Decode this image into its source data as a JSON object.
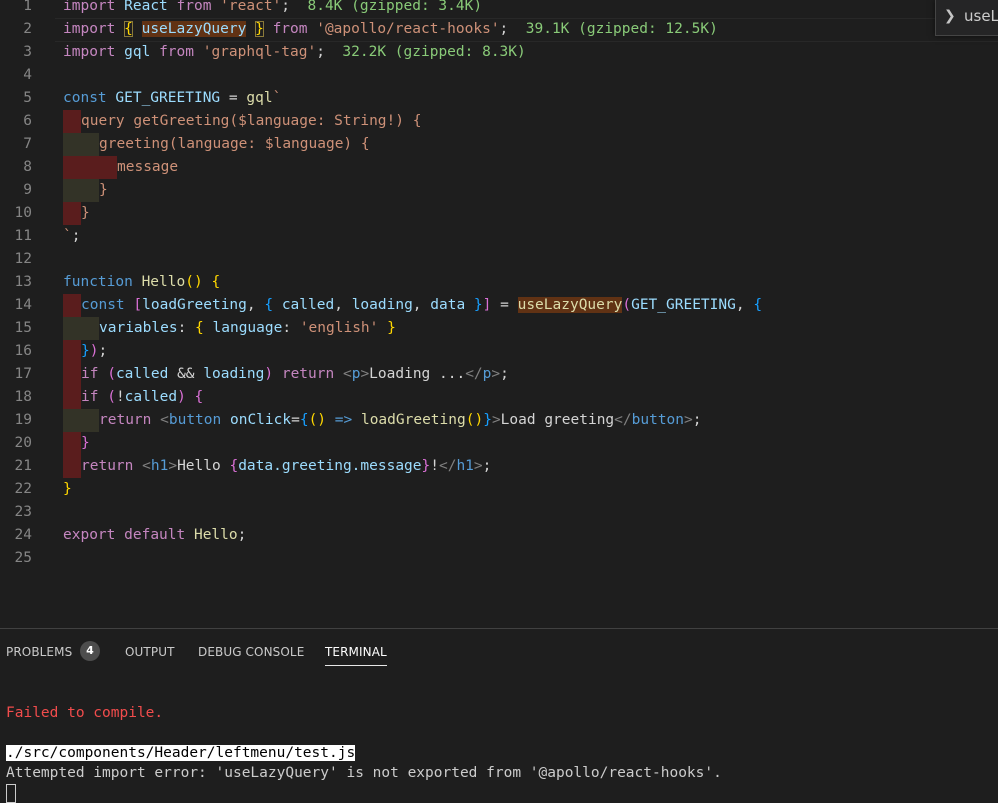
{
  "peek": {
    "text": "useLa"
  },
  "code_lines": [
    {
      "n": "1"
    },
    {
      "n": "2"
    },
    {
      "n": "3"
    },
    {
      "n": "4"
    },
    {
      "n": "5"
    },
    {
      "n": "6"
    },
    {
      "n": "7"
    },
    {
      "n": "8"
    },
    {
      "n": "9"
    },
    {
      "n": "10"
    },
    {
      "n": "11"
    },
    {
      "n": "12"
    },
    {
      "n": "13"
    },
    {
      "n": "14"
    },
    {
      "n": "15"
    },
    {
      "n": "16"
    },
    {
      "n": "17"
    },
    {
      "n": "18"
    },
    {
      "n": "19"
    },
    {
      "n": "20"
    },
    {
      "n": "21"
    },
    {
      "n": "22"
    },
    {
      "n": "23"
    },
    {
      "n": "24"
    },
    {
      "n": "25"
    }
  ],
  "code": {
    "l1": {
      "import_kw": "import",
      "name": "React",
      "from_kw": "from",
      "module": "'react'",
      "size": "8.4K (gzipped: 3.4K)"
    },
    "l2": {
      "import_kw": "import",
      "open": "{",
      "name": "useLazyQuery",
      "close": "}",
      "from_kw": "from",
      "module": "'@apollo/react-hooks'",
      "size": "39.1K (gzipped: 12.5K)"
    },
    "l3": {
      "import_kw": "import",
      "name": "gql",
      "from_kw": "from",
      "module": "'graphql-tag'",
      "size": "32.2K (gzipped: 8.3K)"
    },
    "l5": {
      "const_kw": "const",
      "name": "GET_GREETING",
      "eq": "=",
      "tag": "gql",
      "tick": "`"
    },
    "l6": {
      "text": "query getGreeting($language: String!) {"
    },
    "l7": {
      "text": "greeting(language: $language) {"
    },
    "l8": {
      "text": "message"
    },
    "l9": {
      "text": "}"
    },
    "l10": {
      "text": "}"
    },
    "l11": {
      "tick": "`",
      "semi": ";"
    },
    "l13": {
      "fn_kw": "function",
      "name": "Hello",
      "parens": "()",
      "brace": "{"
    },
    "l14": {
      "const_kw": "const",
      "b_open": "[",
      "v1": "loadGreeting",
      "c1": ",",
      "o_open": "{",
      "v2": "called",
      "c2": ",",
      "v3": "loading",
      "c3": ",",
      "v4": "data",
      "o_close": "}",
      "b_close": "]",
      "eq": "=",
      "call": "useLazyQuery",
      "p_open": "(",
      "arg": "GET_GREETING",
      "c4": ",",
      "obj": "{"
    },
    "l15": {
      "key": "variables",
      "colon": ":",
      "o_open": "{",
      "k2": "language",
      "colon2": ":",
      "val": "'english'",
      "o_close": "}"
    },
    "l16": {
      "close": "}",
      "paren": ")",
      "semi": ";"
    },
    "l17": {
      "if_kw": "if",
      "p_open": "(",
      "v1": "called",
      "op": "&&",
      "v2": "loading",
      "p_close": ")",
      "ret": "return",
      "tag_o": "<",
      "tag": "p",
      "tag_c": ">",
      "text": "Loading ...",
      "end_o": "</",
      "end_c": ">",
      "semi": ";"
    },
    "l18": {
      "if_kw": "if",
      "p_open": "(",
      "not": "!",
      "v1": "called",
      "p_close": ")",
      "brace": "{"
    },
    "l19": {
      "ret": "return",
      "tag_o": "<",
      "tag": "button",
      "attr": "onClick",
      "eq": "=",
      "b_open": "{",
      "p1": "()",
      "arrow": "=>",
      "call": "loadGreeting",
      "p2": "()",
      "b_close": "}",
      "tag_c": ">",
      "text": "Load greeting",
      "end_o": "</",
      "end_tag": "button",
      "end_c": ">",
      "semi": ";"
    },
    "l20": {
      "brace": "}"
    },
    "l21": {
      "ret": "return",
      "tag_o": "<",
      "tag": "h1",
      "tag_c": ">",
      "text": "Hello ",
      "b_open": "{",
      "expr": "data.greeting.message",
      "b_close": "}",
      "bang": "!",
      "end_o": "</",
      "end_tag": "h1",
      "end_c": ">",
      "semi": ";"
    },
    "l22": {
      "brace": "}"
    },
    "l24": {
      "export_kw": "export",
      "default_kw": "default",
      "name": "Hello",
      "semi": ";"
    }
  },
  "panel": {
    "tabs": [
      {
        "label": "PROBLEMS"
      },
      {
        "label": "OUTPUT"
      },
      {
        "label": "DEBUG CONSOLE"
      },
      {
        "label": "TERMINAL"
      }
    ],
    "problems_count": "4",
    "terminal": {
      "error_title": "Failed to compile.",
      "file_path": "./src/components/Header/leftmenu/test.js",
      "message": "Attempted import error: 'useLazyQuery' is not exported from '@apollo/react-hooks'."
    }
  },
  "colors": {
    "background": "#1e1e1e",
    "error": "#f14c4c",
    "keyword": "#c586c0",
    "string": "#ce9178",
    "variable": "#9cdcfe",
    "function": "#dcdcaa",
    "import_size": "#89ca78"
  }
}
